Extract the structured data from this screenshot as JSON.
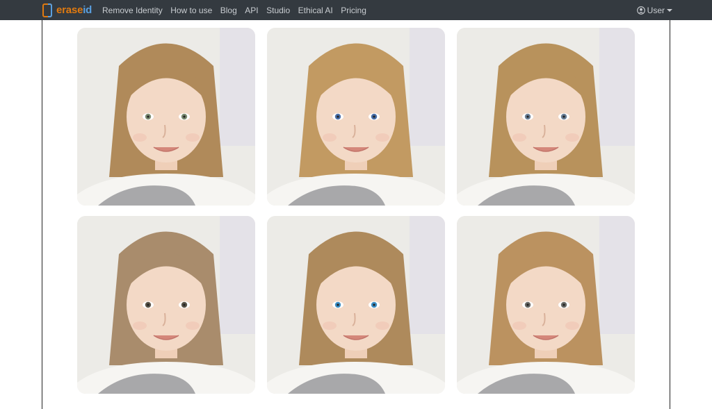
{
  "navbar": {
    "brand": {
      "part1": "erase",
      "part2": "id"
    },
    "links": [
      {
        "label": "Remove Identity"
      },
      {
        "label": "How to use"
      },
      {
        "label": "Blog"
      },
      {
        "label": "API"
      },
      {
        "label": "Studio"
      },
      {
        "label": "Ethical AI"
      },
      {
        "label": "Pricing"
      }
    ],
    "user": {
      "label": "User"
    }
  },
  "gallery": {
    "images": [
      {
        "hair": "#b08a5a",
        "eyes": "#7a8a70"
      },
      {
        "hair": "#c29a62",
        "eyes": "#4a6fa8"
      },
      {
        "hair": "#b8925c",
        "eyes": "#6a7f96"
      },
      {
        "hair": "#a98c6c",
        "eyes": "#5a5448"
      },
      {
        "hair": "#ae8a5c",
        "eyes": "#3e8fc4"
      },
      {
        "hair": "#bb9260",
        "eyes": "#6a6a66"
      }
    ]
  },
  "colors": {
    "navbar": "#343a40",
    "brand_orange": "#e07a10",
    "brand_blue": "#5aa0e0"
  }
}
